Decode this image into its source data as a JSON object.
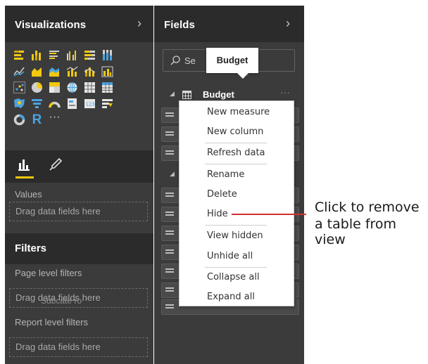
{
  "visualizations": {
    "title": "Visualizations",
    "chevron": "›",
    "icon_rows": [
      [
        "stacked-bar-icon",
        "stacked-column-icon",
        "clustered-bar-icon",
        "clustered-column-icon",
        "100-stacked-bar-icon",
        "100-stacked-column-icon"
      ],
      [
        "line-chart-icon",
        "area-chart-icon",
        "stacked-area-icon",
        "line-and-column-icon",
        "line-and-stacked-column-icon",
        "ribbon-chart-icon"
      ],
      [
        "scatter-chart-icon",
        "pie-chart-icon",
        "treemap-icon",
        "globe-map-icon",
        "table-icon",
        "matrix-icon"
      ],
      [
        "filled-map-icon",
        "funnel-icon",
        "gauge-icon",
        "card-icon",
        "multi-row-card-icon",
        "slicer-icon"
      ],
      [
        "donut-chart-icon",
        "r-visual-icon",
        "more-visuals-icon"
      ]
    ],
    "values_label": "Values",
    "values_drop": "Drag data fields here",
    "accent_color": "#f2c811"
  },
  "filters": {
    "title": "Filters",
    "page_label": "Page level filters",
    "page_drop": "Drag data fields here",
    "report_label": "Report level filters",
    "report_drop": "Drag data fields here"
  },
  "fields": {
    "title": "Fields",
    "chevron": "›",
    "search_placeholder": "Se",
    "tooltip": "Budget",
    "table_name": "Budget",
    "ellipsis": "···",
    "partial_field": "Subcate ro"
  },
  "context_menu": {
    "items": [
      "New measure",
      "New column",
      "Refresh data",
      "Rename",
      "Delete",
      "Hide",
      "View hidden",
      "Unhide all",
      "Collapse all",
      "Expand all"
    ]
  },
  "callout": {
    "line1": "Click to remove",
    "line2": "a table from view",
    "color": "#d32f2f"
  }
}
